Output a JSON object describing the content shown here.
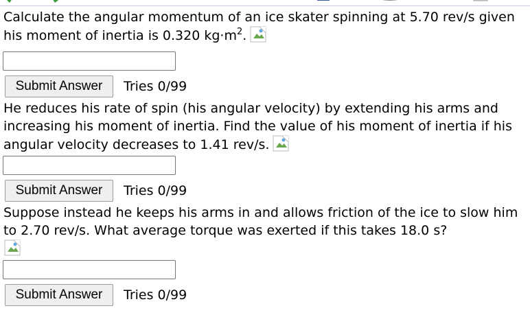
{
  "questions": [
    {
      "text_before_sup": "Calculate the angular momentum of an ice skater spinning at 5.70 rev/s given his moment of inertia is 0.320 kg·m",
      "sup": "2",
      "text_after_sup": ".",
      "answer_value": "",
      "submit_label": "Submit Answer",
      "tries": "Tries 0/99"
    },
    {
      "text": "He reduces his rate of spin (his angular velocity) by extending his arms and increasing his moment of inertia. Find the value of his moment of inertia if his angular velocity decreases to 1.41 rev/s.",
      "answer_value": "",
      "submit_label": "Submit Answer",
      "tries": "Tries 0/99"
    },
    {
      "text": "Suppose instead he keeps his arms in and allows friction of the ice to slow him to 2.70 rev/s. What average torque was exerted if this takes 18.0 s?",
      "answer_value": "",
      "submit_label": "Submit Answer",
      "tries": "Tries 0/99"
    }
  ],
  "icons": {
    "broken_image": "broken-image-icon"
  }
}
